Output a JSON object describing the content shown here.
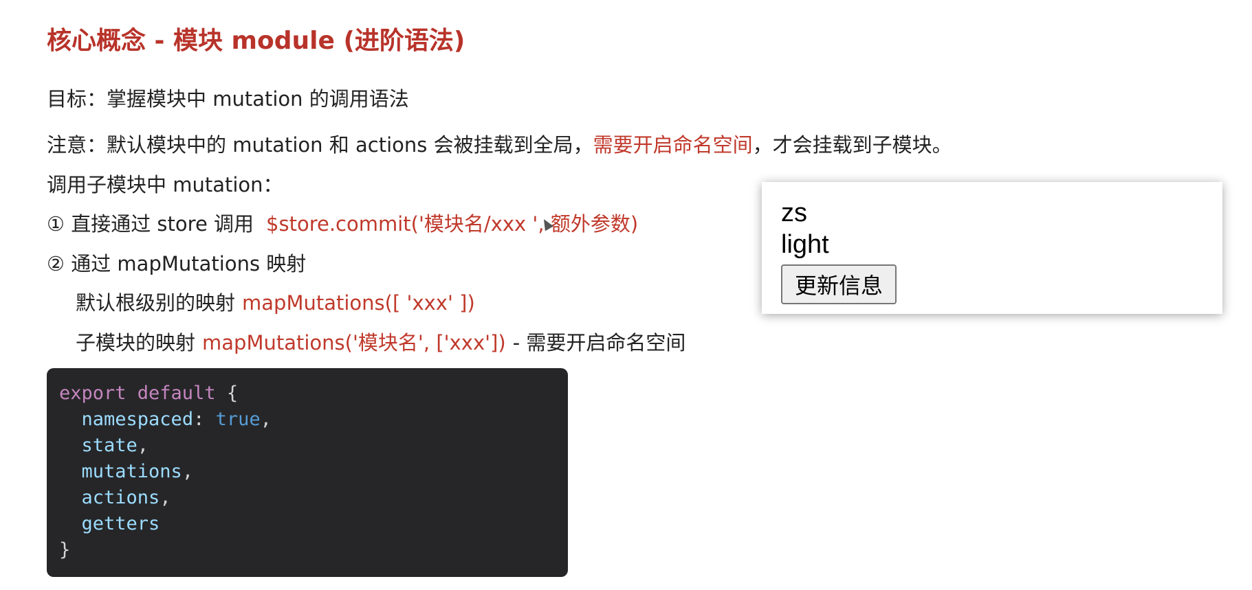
{
  "title": "核心概念 - 模块 module (进阶语法)",
  "goal": "目标：掌握模块中 mutation 的调用语法",
  "note": {
    "prefix": "注意：默认模块中的 mutation 和 actions 会被挂载到全局，",
    "highlight": "需要开启命名空间",
    "suffix": "，才会挂载到子模块。"
  },
  "call_heading": "调用子模块中 mutation：",
  "option1": {
    "text": "① 直接通过 store 调用",
    "code": "$store.commit('模块名/xxx ', 额外参数)"
  },
  "option2": {
    "text": "② 通过 mapMutations 映射"
  },
  "root_mapping": {
    "text": "默认根级别的映射",
    "code": "mapMutations([ 'xxx' ])"
  },
  "sub_mapping": {
    "text": "子模块的映射",
    "code": "mapMutations('模块名', ['xxx'])",
    "suffix": "-  需要开启命名空间"
  },
  "code_block": {
    "line1_kw": "export default",
    "line1_brace": " {",
    "line2_key": "namespaced",
    "line2_sep": ": ",
    "line2_val": "true",
    "line2_end": ",",
    "line3": "state",
    "line3_end": ",",
    "line4": "mutations",
    "line4_end": ",",
    "line5": "actions",
    "line5_end": ",",
    "line6": "getters",
    "line7": "}"
  },
  "preview": {
    "name": "zs",
    "theme": "light",
    "button_label": "更新信息"
  },
  "colors": {
    "title": "#b8332a",
    "highlight": "#c0392b",
    "code_bg": "#262628"
  }
}
